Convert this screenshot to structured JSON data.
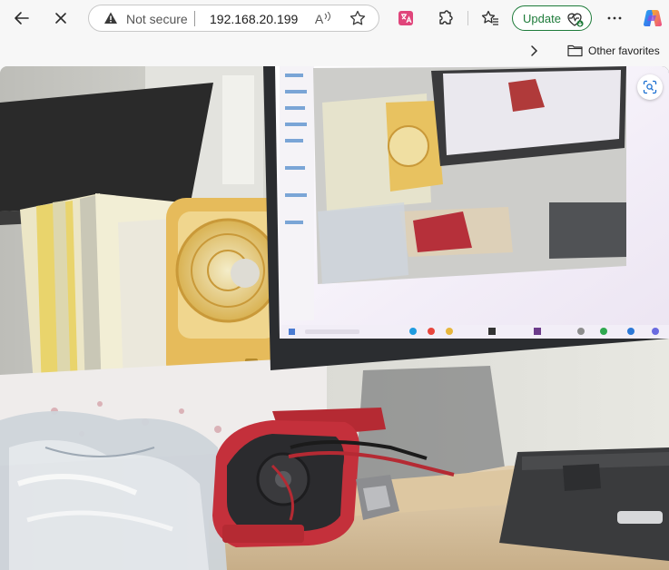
{
  "toolbar": {
    "security_label": "Not secure",
    "url": "192.168.20.199",
    "read_aloud_glyph": "A",
    "update_label": "Update",
    "accent": "#1e7b3a"
  },
  "favorites_bar": {
    "other_favorites_label": "Other favorites"
  },
  "icons": [
    "back-icon",
    "close-icon",
    "warning-icon",
    "read-aloud-icon",
    "favorite-star-icon",
    "translate-icon",
    "extensions-icon",
    "favorites-icon",
    "heart-pulse-icon",
    "more-icon",
    "copilot-icon",
    "chevron-right-icon",
    "folder-icon",
    "visual-search-icon"
  ],
  "content": {
    "type": "camera-feed-image",
    "description_visible": "webcam view of desk with monitor, books, yellow fan and red multimeter"
  }
}
